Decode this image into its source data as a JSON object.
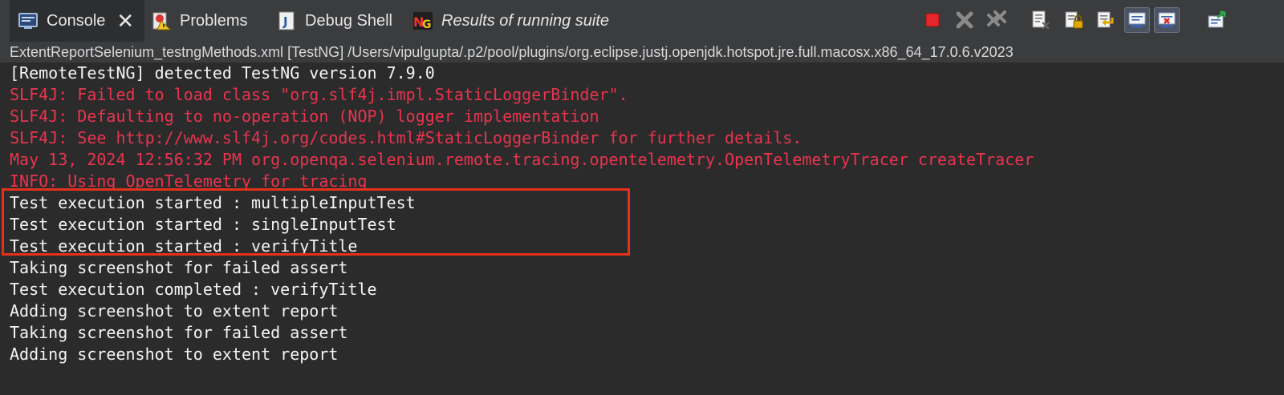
{
  "tabs": [
    {
      "label": "Console",
      "icon": "console-icon",
      "active": true
    },
    {
      "label": "Problems",
      "icon": "problems-icon"
    },
    {
      "label": "Debug Shell",
      "icon": "debug-shell-icon"
    },
    {
      "label": "Results of running suite",
      "icon": "testng-icon",
      "italic": true
    }
  ],
  "toolbar": [
    {
      "icon": "terminate-icon"
    },
    {
      "icon": "remove-launch-icon"
    },
    {
      "icon": "remove-all-terminated-icon"
    },
    {
      "icon": "clear-console-icon"
    },
    {
      "icon": "scroll-lock-icon"
    },
    {
      "icon": "word-wrap-icon"
    },
    {
      "icon": "show-on-stdout-icon"
    },
    {
      "icon": "show-on-stderr-icon"
    },
    {
      "icon": "pin-console-icon"
    }
  ],
  "launch_path": "ExtentReportSelenium_testngMethods.xml [TestNG] /Users/vipulgupta/.p2/pool/plugins/org.eclipse.justj.openjdk.hotspot.jre.full.macosx.x86_64_17.0.6.v2023",
  "console_lines": [
    {
      "text": "[RemoteTestNG] detected TestNG version 7.9.0",
      "stream": "out"
    },
    {
      "text": "SLF4J: Failed to load class \"org.slf4j.impl.StaticLoggerBinder\".",
      "stream": "err"
    },
    {
      "text": "SLF4J: Defaulting to no-operation (NOP) logger implementation",
      "stream": "err"
    },
    {
      "text": "SLF4J: See http://www.slf4j.org/codes.html#StaticLoggerBinder for further details.",
      "stream": "err"
    },
    {
      "text": "May 13, 2024 12:56:32 PM org.openqa.selenium.remote.tracing.opentelemetry.OpenTelemetryTracer createTracer",
      "stream": "err"
    },
    {
      "text": "INFO: Using OpenTelemetry for tracing",
      "stream": "err"
    },
    {
      "text": "Test execution started : multipleInputTest",
      "stream": "out"
    },
    {
      "text": "Test execution started : singleInputTest",
      "stream": "out"
    },
    {
      "text": "Test execution started : verifyTitle",
      "stream": "out"
    },
    {
      "text": "Taking screenshot for failed assert",
      "stream": "out"
    },
    {
      "text": "Test execution completed : verifyTitle",
      "stream": "out"
    },
    {
      "text": "Adding screenshot to extent report",
      "stream": "out"
    },
    {
      "text": "Taking screenshot for failed assert",
      "stream": "out"
    },
    {
      "text": "Adding screenshot to extent report",
      "stream": "out"
    }
  ],
  "colors": {
    "stdout": "#f4f4f4",
    "stderr": "#e8344e",
    "highlight_box": "#e5311c",
    "background": "#2b2b2b"
  }
}
